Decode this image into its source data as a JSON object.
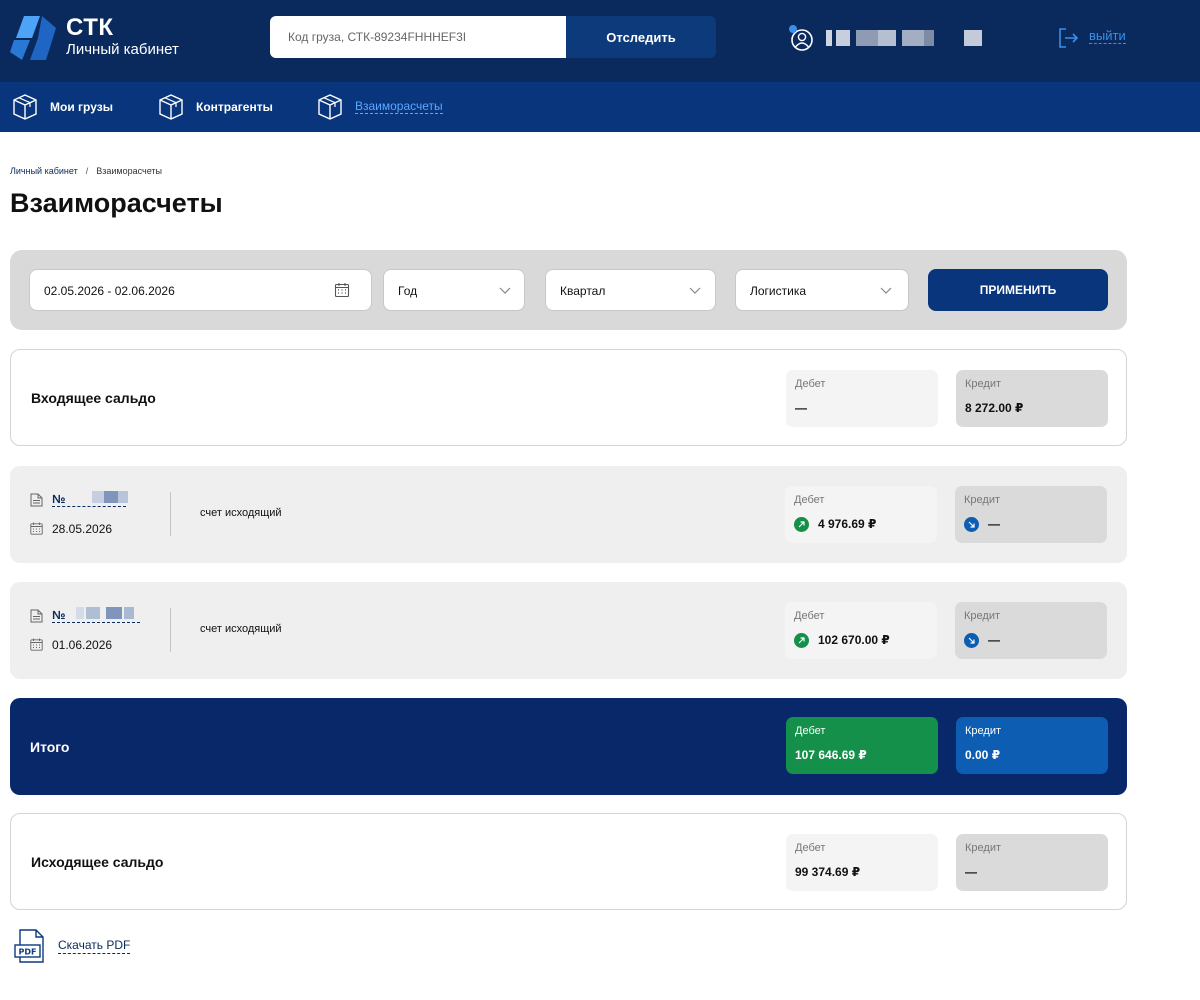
{
  "header": {
    "logo_title": "СТК",
    "logo_subtitle": "Личный кабинет",
    "track_placeholder": "Код груза, СТК-89234FHHHEF3I",
    "track_button": "Отследить",
    "logout_label": "выйти"
  },
  "nav": {
    "items": [
      {
        "label": "Мои грузы"
      },
      {
        "label": "Контрагенты"
      },
      {
        "label": "Взаиморасчеты",
        "active": true
      }
    ]
  },
  "breadcrumb": {
    "home": "Личный кабинет",
    "separator": "/",
    "current": "Взаиморасчеты"
  },
  "page_title": "Взаиморасчеты",
  "filters": {
    "date_range": "02.05.2026 - 02.06.2026",
    "year": "Год",
    "quarter": "Квартал",
    "service": "Логистика",
    "apply_button": "ПРИМЕНИТЬ"
  },
  "labels": {
    "debit": "Дебет",
    "credit": "Кредит"
  },
  "opening_balance": {
    "title": "Входящее сальдо",
    "debit": "—",
    "credit": "8 272.00 ₽"
  },
  "documents": [
    {
      "number": "№",
      "date": "28.05.2026",
      "type": "счет исходящий",
      "debit": "4 976.69 ₽",
      "credit": "—"
    },
    {
      "number": "№",
      "date": "01.06.2026",
      "type": "счет исходящий",
      "debit": "102 670.00 ₽",
      "credit": "—"
    }
  ],
  "total": {
    "title": "Итого",
    "debit": "107 646.69 ₽",
    "credit": "0.00 ₽"
  },
  "closing_balance": {
    "title": "Исходящее сальдо",
    "debit": "99 374.69 ₽",
    "credit": "—"
  },
  "download": {
    "label": "Скачать PDF",
    "icon_text": "PDF"
  },
  "colors": {
    "header_bg": "#0a2a5e",
    "nav_bg": "#08357c",
    "accent_link": "#3a8fe8",
    "debit_green": "#14904a",
    "credit_blue": "#0d5db3"
  },
  "icons": [
    "logo-icon",
    "user-icon",
    "logout-icon",
    "box-icon",
    "calendar-icon",
    "chevron-down-icon",
    "document-icon",
    "arrow-up-right-icon",
    "arrow-down-right-icon",
    "pdf-icon"
  ]
}
